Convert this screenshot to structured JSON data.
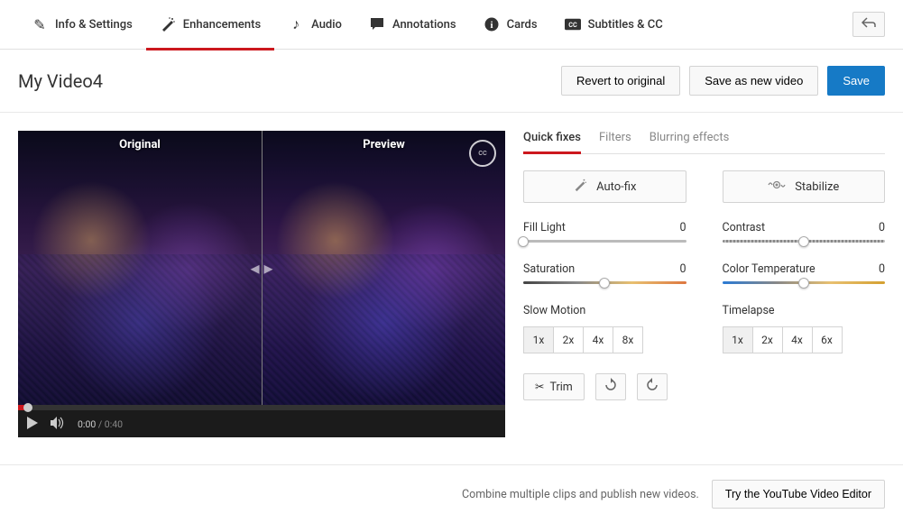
{
  "top_tabs": {
    "info": "Info & Settings",
    "enhancements": "Enhancements",
    "audio": "Audio",
    "annotations": "Annotations",
    "cards": "Cards",
    "subtitles": "Subtitles & CC"
  },
  "title": "My Video4",
  "buttons": {
    "revert": "Revert to original",
    "save_as_new": "Save as new video",
    "save": "Save",
    "auto_fix": "Auto-fix",
    "stabilize": "Stabilize",
    "trim": "Trim",
    "try_editor": "Try the YouTube Video Editor"
  },
  "preview": {
    "original_label": "Original",
    "preview_label": "Preview"
  },
  "player": {
    "current_time": "0:00",
    "duration": "0:40"
  },
  "sub_tabs": {
    "quick_fixes": "Quick fixes",
    "filters": "Filters",
    "blurring": "Blurring effects"
  },
  "sliders": {
    "fill_light": {
      "label": "Fill Light",
      "value": "0",
      "pos": 0
    },
    "contrast": {
      "label": "Contrast",
      "value": "0",
      "pos": 50
    },
    "saturation": {
      "label": "Saturation",
      "value": "0",
      "pos": 50
    },
    "color_temp": {
      "label": "Color Temperature",
      "value": "0",
      "pos": 50
    }
  },
  "slow_motion": {
    "label": "Slow Motion",
    "options": [
      "1x",
      "2x",
      "4x",
      "8x"
    ],
    "active": "1x"
  },
  "timelapse": {
    "label": "Timelapse",
    "options": [
      "1x",
      "2x",
      "4x",
      "6x"
    ],
    "active": "1x"
  },
  "footer_text": "Combine multiple clips and publish new videos."
}
